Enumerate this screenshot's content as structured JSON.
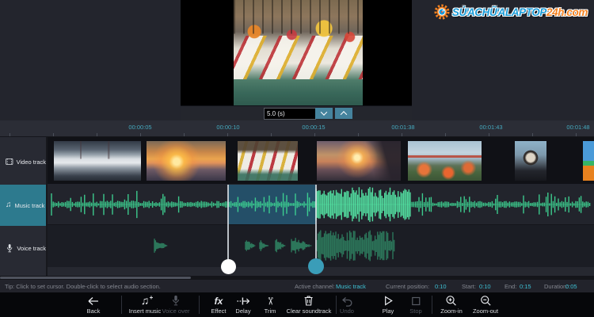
{
  "logo": {
    "primary": "SỬACHỮALAPTOP",
    "secondary": "24h.com"
  },
  "preview": {
    "duration_value": "5.0 (s)"
  },
  "ruler": {
    "ticks": [
      "00:00:05",
      "00:00:10",
      "00:00:15",
      "00:01:38",
      "00:01:43",
      "00:01:48"
    ]
  },
  "sidebar": {
    "video_label": "Video track",
    "music_label": "Music track",
    "voice_label": "Voice track"
  },
  "status": {
    "tip": "Tip: Click to set cursor. Double-click to select audio section.",
    "active_channel_label": "Active channel:",
    "active_channel_value": "Music track",
    "current_position_label": "Current position:",
    "current_position_value": "0:10",
    "start_label": "Start:",
    "start_value": "0:10",
    "end_label": "End:",
    "end_value": "0:15",
    "duration_label": "Duration:",
    "duration_value": "0:05"
  },
  "toolbar": {
    "back": "Back",
    "insert_music": "Insert music",
    "voice_over": "Voice over",
    "effect": "Effect",
    "delay": "Delay",
    "trim": "Trim",
    "clear_soundtrack": "Clear soundtrack",
    "undo": "Undo",
    "play": "Play",
    "stop": "Stop",
    "zoom_in": "Zoom-in",
    "zoom_out": "Zoom-out"
  },
  "colors": {
    "active_track_teal": "#2d7a8e",
    "waveform_green": "#3ed492",
    "value_teal": "#3ec1d4",
    "selection_blue": "#26769f",
    "logo_blue": "#1a9cd8",
    "logo_orange": "#f58220"
  }
}
